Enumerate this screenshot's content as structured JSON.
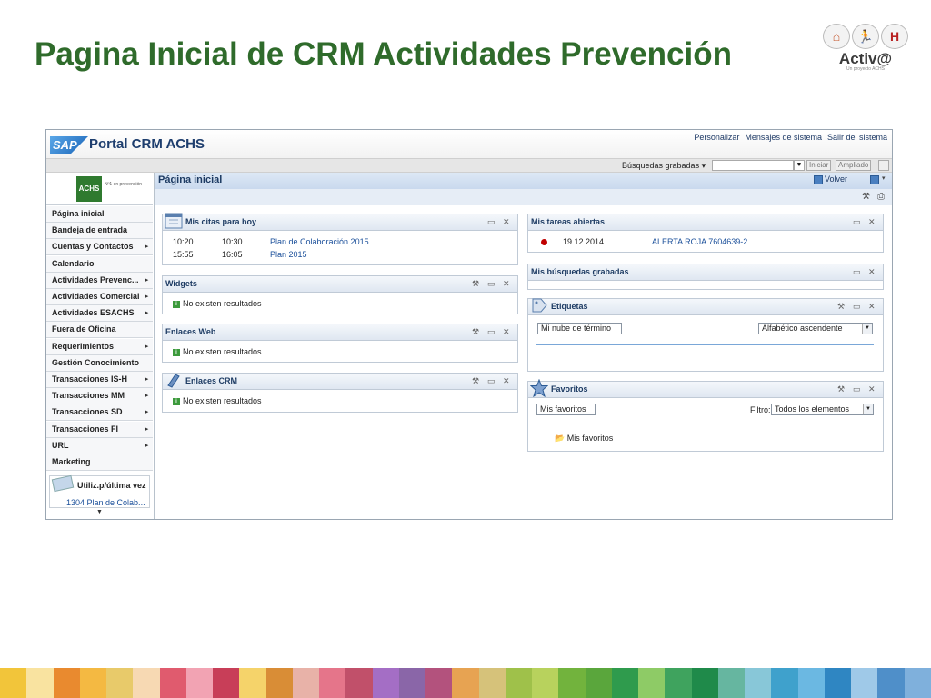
{
  "slide": {
    "title": "Pagina Inicial de CRM Actividades Prevención",
    "logo_text": "Activ@",
    "logo_sub": "Un proyecto ACHS"
  },
  "portal": {
    "brand": "SAP",
    "title": "Portal CRM ACHS",
    "top_links": [
      "Personalizar",
      "Mensajes de sistema",
      "Salir del sistema"
    ],
    "saved_searches_label": "Búsquedas grabadas ▾",
    "search_value": "",
    "btn_start": "Iniciar",
    "btn_advanced": "Ampliado"
  },
  "nav": {
    "logo_text": "ACHS",
    "logo_tagline": "Nº1 en prevención",
    "items": [
      {
        "label": "Página inicial",
        "arrow": ""
      },
      {
        "label": "Bandeja de entrada",
        "arrow": ""
      },
      {
        "label": "Cuentas y Contactos",
        "arrow": "▸"
      },
      {
        "label": "Calendario",
        "arrow": ""
      },
      {
        "label": "Actividades Prevenc...",
        "arrow": "▸"
      },
      {
        "label": "Actividades Comercial",
        "arrow": "▸"
      },
      {
        "label": "Actividades ESACHS",
        "arrow": "▸"
      },
      {
        "label": "Fuera de Oficina",
        "arrow": ""
      },
      {
        "label": "Requerimientos",
        "arrow": "▸"
      },
      {
        "label": "Gestión Conocimiento",
        "arrow": ""
      },
      {
        "label": "Transacciones IS-H",
        "arrow": "▸"
      },
      {
        "label": "Transacciones MM",
        "arrow": "▸"
      },
      {
        "label": "Transacciones SD",
        "arrow": "▸"
      },
      {
        "label": "Transacciones FI",
        "arrow": "▸"
      },
      {
        "label": "URL",
        "arrow": "▸"
      },
      {
        "label": "Marketing",
        "arrow": ""
      }
    ],
    "recent_title": "Utiliz.p/última vez",
    "recent_link": "1304 Plan de Colab..."
  },
  "main": {
    "page_title": "Página inicial",
    "back_label": "Volver",
    "citas": {
      "title": "Mis citas para hoy",
      "rows": [
        {
          "start": "10:20",
          "end": "10:30",
          "subject": "Plan de Colaboración 2015"
        },
        {
          "start": "15:55",
          "end": "16:05",
          "subject": "Plan 2015"
        }
      ]
    },
    "widgets": {
      "title": "Widgets",
      "empty": "No existen resultados"
    },
    "enlaces_web": {
      "title": "Enlaces Web",
      "empty": "No existen resultados"
    },
    "enlaces_crm": {
      "title": "Enlaces CRM",
      "empty": "No existen resultados"
    },
    "tareas": {
      "title": "Mis tareas abiertas",
      "rows": [
        {
          "date": "19.12.2014",
          "subject": "ALERTA ROJA 7604639-2"
        }
      ]
    },
    "busquedas": {
      "title": "Mis búsquedas grabadas"
    },
    "etiquetas": {
      "title": "Etiquetas",
      "cloud_select": "Mi nube de término",
      "sort_select": "Alfabético ascendente"
    },
    "favoritos": {
      "title": "Favoritos",
      "select": "Mis favoritos",
      "filter_label": "Filtro:",
      "filter_value": "Todos los elementos",
      "folder": "Mis favoritos"
    }
  },
  "colors": {
    "title_green": "#2f6b2b",
    "header_blue": "#1d3b63",
    "link_blue": "#1a4f9a"
  }
}
